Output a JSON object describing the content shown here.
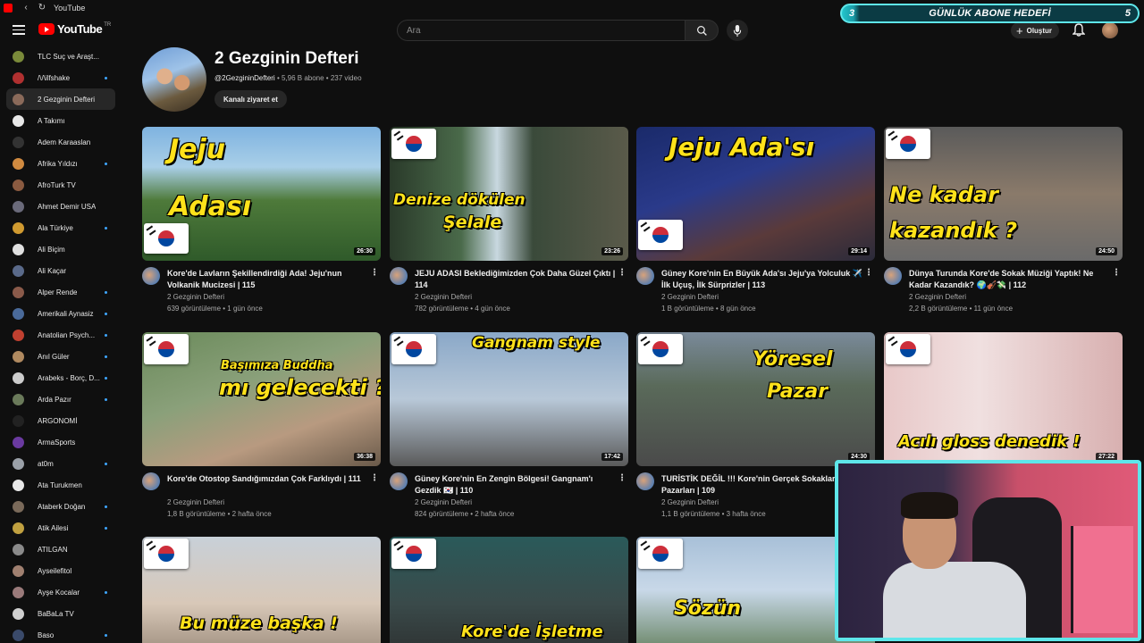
{
  "window": {
    "title": "YouTube"
  },
  "header": {
    "logo_text": "YouTube",
    "logo_region": "TR",
    "search_placeholder": "Ara",
    "create_label": "Oluştur"
  },
  "goal_overlay": {
    "left_value": "3",
    "title": "GÜNLÜK ABONE HEDEFİ",
    "right_value": "5"
  },
  "sidebar": {
    "items": [
      {
        "label": "TLC Suç ve Araşt...",
        "color": "#7a8a3a",
        "dot": false,
        "active": false
      },
      {
        "label": "/\\/\\ilfshake",
        "color": "#b03030",
        "dot": true,
        "active": false
      },
      {
        "label": "2 Gezginin Defteri",
        "color": "#8a6a5a",
        "dot": false,
        "active": true
      },
      {
        "label": "A Takımı",
        "color": "#e8e8e8",
        "dot": false,
        "active": false
      },
      {
        "label": "Adem Karaaslan",
        "color": "#333333",
        "dot": false,
        "active": false
      },
      {
        "label": "Afrika Yıldızı",
        "color": "#d08a40",
        "dot": true,
        "active": false
      },
      {
        "label": "AfroTurk TV",
        "color": "#8a5a40",
        "dot": false,
        "active": false
      },
      {
        "label": "Ahmet Demir USA",
        "color": "#6a6a7a",
        "dot": false,
        "active": false
      },
      {
        "label": "Ala Türkiye",
        "color": "#d09a30",
        "dot": true,
        "active": false
      },
      {
        "label": "Ali Biçim",
        "color": "#e0e0e0",
        "dot": false,
        "active": false
      },
      {
        "label": "Ali Kaçar",
        "color": "#5a6a8a",
        "dot": false,
        "active": false
      },
      {
        "label": "Alper Rende",
        "color": "#8a5a4a",
        "dot": true,
        "active": false
      },
      {
        "label": "Amerikali Aynasiz",
        "color": "#4a6a9a",
        "dot": true,
        "active": false
      },
      {
        "label": "Anatolian Psych...",
        "color": "#c04030",
        "dot": true,
        "active": false
      },
      {
        "label": "Anıl Güler",
        "color": "#b08a60",
        "dot": true,
        "active": false
      },
      {
        "label": "Arabeks - Borç, D...",
        "color": "#cccccc",
        "dot": true,
        "active": false
      },
      {
        "label": "Arda Pazır",
        "color": "#6a7a5a",
        "dot": true,
        "active": false
      },
      {
        "label": "ARGONOMİ",
        "color": "#222222",
        "dot": false,
        "active": false
      },
      {
        "label": "ArmaSports",
        "color": "#6a3aa0",
        "dot": false,
        "active": false
      },
      {
        "label": "at0m",
        "color": "#9aa0a8",
        "dot": true,
        "active": false
      },
      {
        "label": "Ata Turukmen",
        "color": "#e8e8e8",
        "dot": false,
        "active": false
      },
      {
        "label": "Ataberk Doğan",
        "color": "#7a6a5a",
        "dot": true,
        "active": false
      },
      {
        "label": "Atik Ailesi",
        "color": "#c0a040",
        "dot": true,
        "active": false
      },
      {
        "label": "ATILGAN",
        "color": "#8a8a8a",
        "dot": false,
        "active": false
      },
      {
        "label": "Ayseilefitol",
        "color": "#a08070",
        "dot": false,
        "active": false
      },
      {
        "label": "Ayşe Kocalar",
        "color": "#9a7a7a",
        "dot": true,
        "active": false
      },
      {
        "label": "BaBaLa TV",
        "color": "#d0d0d0",
        "dot": false,
        "active": false
      },
      {
        "label": "Baso",
        "color": "#3a4a6a",
        "dot": true,
        "active": false
      }
    ]
  },
  "channel": {
    "name": "2 Gezginin Defteri",
    "handle": "@2GezgininDefteri",
    "meta": "• 5,96 B abone • 237 video",
    "visit_label": "Kanalı ziyaret et"
  },
  "videos": [
    {
      "title": "Kore'de Lavların Şekillendirdiği Ada! Jeju'nun Volkanik Mucizesi | 115",
      "channel": "2 Gezginin Defteri",
      "meta": "639 görüntüleme • 1 gün önce",
      "duration": "26:30",
      "thumb_text": [
        "Jeju",
        "Adası"
      ],
      "bg": "linear-gradient(180deg, #7fb3e0 0%, #a9cfe8 30%, #4e7a3a 55%, #2f5a2a 100%)"
    },
    {
      "title": "JEJU ADASI Beklediğimizden Çok Daha Güzel Çıktı | 114",
      "channel": "2 Gezginin Defteri",
      "meta": "782 görüntüleme • 4 gün önce",
      "duration": "23:26",
      "thumb_text": [
        "Denize dökülen",
        "Şelale"
      ],
      "bg": "linear-gradient(90deg, #2a3a2a 0%, #4a6a4a 30%, #c8d8e0 45%, #3a4a3a 60%, #5a5a4a 100%)"
    },
    {
      "title": "Güney Kore'nin En Büyük Ada'sı Jeju'ya Yolculuk ✈️ İlk Uçuş, İlk Sürprizler | 113",
      "channel": "2 Gezginin Defteri",
      "meta": "1 B görüntüleme • 8 gün önce",
      "duration": "29:14",
      "thumb_text": [
        "Jeju Ada'sı",
        ""
      ],
      "bg": "linear-gradient(160deg, #1a2a6a 0%, #2a3a8a 40%, #5a3a3a 70%, #2a2a3a 100%)"
    },
    {
      "title": "Dünya Turunda Kore'de Sokak Müziği Yaptık! Ne Kadar Kazandık? 🌍🎻💸 | 112",
      "channel": "2 Gezginin Defteri",
      "meta": "2,2 B görüntüleme • 11 gün önce",
      "duration": "24:50",
      "thumb_text": [
        "Ne kadar",
        "kazandık ?"
      ],
      "bg": "linear-gradient(180deg, #5a5a5a 0%, #8a7a6a 50%, #6a6a6a 100%)"
    },
    {
      "title": "Kore'de Otostop Sandığımızdan Çok Farklıydı | 111",
      "channel": "2 Gezginin Defteri",
      "meta": "1,8 B görüntüleme • 2 hafta önce",
      "duration": "36:38",
      "thumb_text": [
        "Başımıza Buddha",
        "mı gelecekti ?"
      ],
      "bg": "linear-gradient(160deg, #6a8a5a 0%, #8aa07a 40%, #b89a80 70%, #6a5a4a 100%)"
    },
    {
      "title": "Güney Kore'nin En Zengin Bölgesi! Gangnam'ı Gezdik 🇰🇷 | 110",
      "channel": "2 Gezginin Defteri",
      "meta": "824 görüntüleme • 2 hafta önce",
      "duration": "17:42",
      "thumb_text": [
        "Gangnam style",
        ""
      ],
      "bg": "linear-gradient(180deg, #8aa8c8 0%, #b8c8d8 50%, #5a5a5a 100%)"
    },
    {
      "title": "TURİSTİK DEĞİL !!! Kore'nin Gerçek Sokakları Pazarları | 109",
      "channel": "2 Gezginin Defteri",
      "meta": "1,1 B görüntüleme • 3 hafta önce",
      "duration": "24:30",
      "thumb_text": [
        "Yöresel",
        "Pazar"
      ],
      "bg": "linear-gradient(180deg, #7a8a9a 0%, #5a6a5a 40%, #4a4a4a 100%)"
    },
    {
      "title": "",
      "channel": "",
      "meta": "",
      "duration": "27:22",
      "thumb_text": [
        "Acılı gloss denedik !",
        ""
      ],
      "bg": "linear-gradient(90deg, #e8c8c8 0%, #f0e0e0 40%, #d8b0b0 100%)"
    },
    {
      "title": "",
      "channel": "",
      "meta": "",
      "duration": "",
      "thumb_text": [
        "Bu müze başka !",
        ""
      ],
      "bg": "linear-gradient(180deg, #c8d0d8 0%, #d8c8b8 50%, #8a7a6a 100%)"
    },
    {
      "title": "",
      "channel": "",
      "meta": "",
      "duration": "",
      "thumb_text": [
        "Kore'de İşletme",
        ""
      ],
      "bg": "linear-gradient(180deg, #2a5a5a 0%, #3a4a4a 50%, #2a2a2a 100%)"
    },
    {
      "title": "",
      "channel": "",
      "meta": "",
      "duration": "",
      "thumb_text": [
        "Sözün",
        ""
      ],
      "bg": "linear-gradient(180deg, #a8c0d8 0%, #c8d8e8 40%, #4a6a3a 100%)"
    }
  ]
}
